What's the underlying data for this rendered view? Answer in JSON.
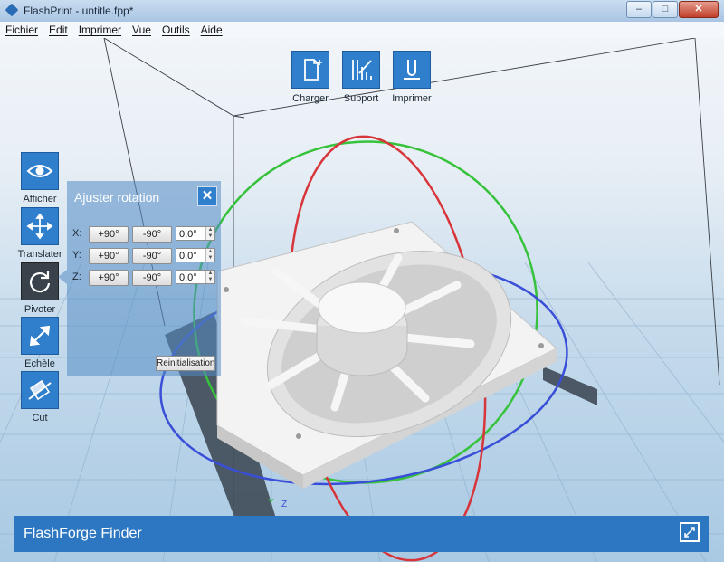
{
  "window": {
    "title": "FlashPrint - untitle.fpp*",
    "buttons": [
      "–",
      "□",
      "✕"
    ]
  },
  "menu": [
    "Fichier",
    "Edit",
    "Imprimer",
    "Vue",
    "Outils",
    "Aide"
  ],
  "top_toolbar": [
    {
      "label": "Charger",
      "icon": "load-file-icon"
    },
    {
      "label": "Support",
      "icon": "support-icon"
    },
    {
      "label": "Imprimer",
      "icon": "print-icon"
    }
  ],
  "left_toolbar": [
    {
      "label": "Afficher",
      "icon": "eye-icon"
    },
    {
      "label": "Translater",
      "icon": "move-icon"
    },
    {
      "label": "Pivoter",
      "icon": "rotate-icon",
      "active": true
    },
    {
      "label": "Echèle",
      "icon": "scale-icon"
    },
    {
      "label": "Cut",
      "icon": "cut-icon"
    }
  ],
  "rotation_panel": {
    "title": "Ajuster rotation",
    "close": "✕",
    "rows": [
      {
        "axis": "X:",
        "plus": "+90°",
        "minus": "-90°",
        "value": "0,0°"
      },
      {
        "axis": "Y:",
        "plus": "+90°",
        "minus": "-90°",
        "value": "0,0°"
      },
      {
        "axis": "Z:",
        "plus": "+90°",
        "minus": "-90°",
        "value": "0,0°"
      }
    ],
    "reset": "Reinitialisation"
  },
  "bottom_bar": {
    "printer": "FlashForge Finder"
  },
  "axis_indicator": {
    "y": "Y",
    "z": "Z"
  },
  "colors": {
    "accent": "#2f7fcd",
    "ring_x": "#d8353a",
    "ring_y": "#37c23c",
    "ring_z": "#3a4fd8"
  }
}
